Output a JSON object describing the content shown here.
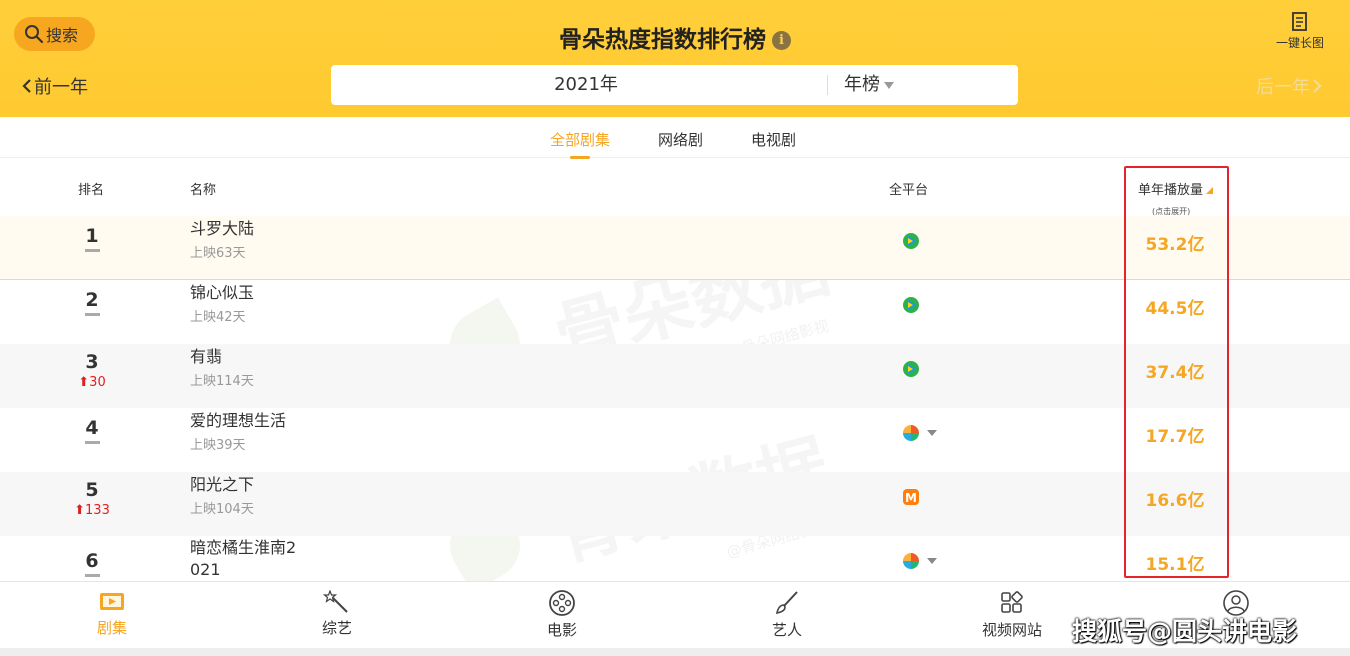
{
  "header": {
    "search_label": "搜索",
    "title": "骨朵热度指数排行榜",
    "info_glyph": "i",
    "long_image_label": "一键长图",
    "prev_label": "前一年",
    "next_label": "后一年",
    "year": "2021年",
    "board": "年榜"
  },
  "tabs": [
    {
      "label": "全部剧集",
      "active": true
    },
    {
      "label": "网络剧",
      "active": false
    },
    {
      "label": "电视剧",
      "active": false
    }
  ],
  "columns": {
    "rank": "排名",
    "name": "名称",
    "platform": "全平台",
    "plays": "单年播放量",
    "plays_hint": "(点击展开)"
  },
  "rows": [
    {
      "rank": "1",
      "change": "",
      "name": "斗罗大陆",
      "days": "上映63天",
      "platform": "tencent",
      "plays": "53.2亿"
    },
    {
      "rank": "2",
      "change": "",
      "name": "锦心似玉",
      "days": "上映42天",
      "platform": "tencent",
      "plays": "44.5亿"
    },
    {
      "rank": "3",
      "change": "30",
      "name": "有翡",
      "days": "上映114天",
      "platform": "tencent",
      "plays": "37.4亿"
    },
    {
      "rank": "4",
      "change": "",
      "name": "爱的理想生活",
      "days": "上映39天",
      "platform": "multi",
      "plays": "17.7亿"
    },
    {
      "rank": "5",
      "change": "133",
      "name": "阳光之下",
      "days": "上映104天",
      "platform": "mango",
      "plays": "16.6亿"
    },
    {
      "rank": "6",
      "change": "",
      "name": "暗恋橘生淮南2\n021",
      "days": "",
      "platform": "multi",
      "plays": "15.1亿"
    }
  ],
  "watermark": {
    "text": "骨朵数据",
    "sub": "@骨朵网络影视"
  },
  "nav": [
    {
      "label": "剧集",
      "icon": "tv-icon",
      "active": true
    },
    {
      "label": "综艺",
      "icon": "magic-wand-icon",
      "active": false
    },
    {
      "label": "电影",
      "icon": "film-reel-icon",
      "active": false
    },
    {
      "label": "艺人",
      "icon": "brush-icon",
      "active": false
    },
    {
      "label": "视频网站",
      "icon": "grid-icon",
      "active": false
    },
    {
      "label": "",
      "icon": "user-icon",
      "active": false
    }
  ],
  "credit": "搜狐号@圆头讲电影",
  "colors": {
    "accent": "#f5a623",
    "header": "#ffc930",
    "highlight_box": "#e8222b",
    "rank_up": "#e02020"
  }
}
